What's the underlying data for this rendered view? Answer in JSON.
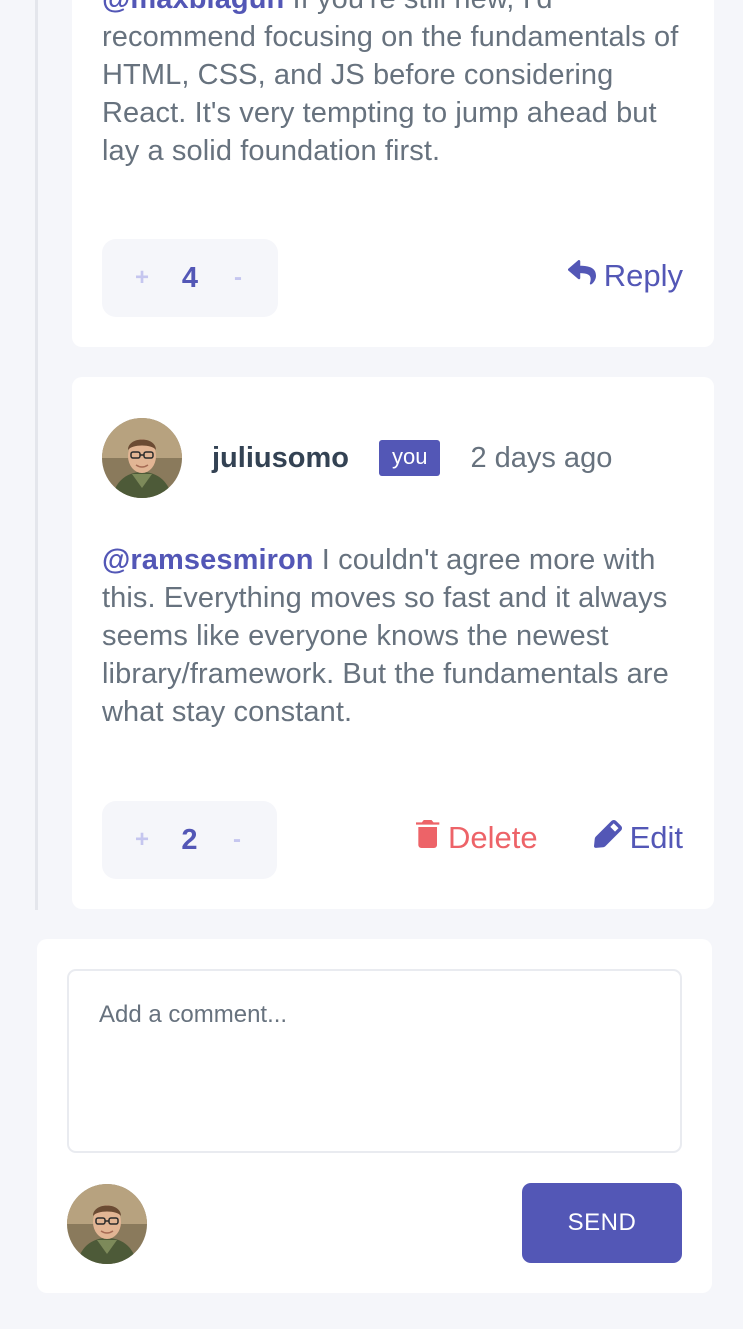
{
  "reply_comment": {
    "mention": "@maxblagun",
    "text": " If you're still new, I'd recommend focusing on the fundamentals of HTML, CSS, and JS before considering React. It's very tempting to jump ahead but lay a solid foundation first.",
    "score": "4",
    "plus": "+",
    "minus": "-",
    "reply_label": "Reply"
  },
  "own_comment": {
    "username": "juliusomo",
    "badge": "you",
    "created_at": "2 days ago",
    "mention": "@ramsesmiron",
    "text": " I couldn't agree more with this. Everything moves so fast and it always seems like everyone knows the newest library/framework. But the fundamentals are what stay constant.",
    "score": "2",
    "plus": "+",
    "minus": "-",
    "delete_label": "Delete",
    "edit_label": "Edit"
  },
  "add_comment": {
    "placeholder": "Add a comment...",
    "send_label": "SEND"
  },
  "colors": {
    "primary": "#5357b6",
    "danger": "#ed6368",
    "text": "#67727e",
    "heading": "#334253",
    "background": "#f5f6fa"
  },
  "icons": {
    "reply": "reply-icon",
    "delete": "trash-icon",
    "edit": "pencil-icon"
  }
}
